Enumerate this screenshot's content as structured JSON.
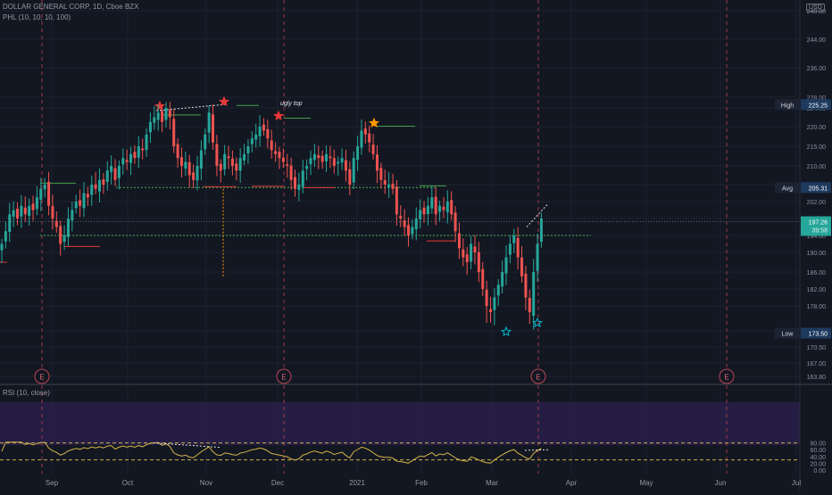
{
  "header": {
    "symbol_line": "DOLLAR GENERAL CORP, 1D, Cboe BZX",
    "indicator_line": "PHL (10, 10, 10, 100)",
    "rsi_line": "RSI (10, close)",
    "currency": "USD"
  },
  "chart_data": [
    {
      "type": "candlestick",
      "ylim": [
        163.8,
        250
      ],
      "y_ticks": [
        163.8,
        167.0,
        170.5,
        174.0,
        178.0,
        182.0,
        186.0,
        190.0,
        194.0,
        198.0,
        202.0,
        206.0,
        210.0,
        215.0,
        220.0,
        224.0,
        228.0,
        236.0,
        244.0,
        248.0
      ],
      "x_ticks": [
        "Sep",
        "Oct",
        "Nov",
        "Dec",
        "2021",
        "Feb",
        "Mar",
        "Apr",
        "May",
        "Jun",
        "Jul"
      ],
      "ohlc_close": [
        192,
        195,
        199,
        200,
        198,
        201,
        199,
        201,
        200,
        203,
        205,
        206,
        201,
        198,
        196,
        192,
        194,
        198,
        200,
        202,
        201,
        204,
        203,
        206,
        205,
        207,
        206,
        209,
        210,
        207,
        210,
        212,
        211,
        213,
        212,
        215,
        214,
        218,
        221,
        222,
        223,
        221,
        224,
        222,
        215,
        212,
        210,
        211,
        208,
        207,
        210,
        214,
        218,
        223,
        216,
        210,
        209,
        213,
        212,
        210,
        209,
        212,
        213,
        215,
        217,
        218,
        220,
        219,
        217,
        214,
        213,
        212,
        211,
        210,
        207,
        205,
        206,
        209,
        210,
        212,
        213,
        212,
        211,
        213,
        212,
        210,
        211,
        212,
        209,
        206,
        212,
        215,
        219,
        218,
        216,
        213,
        209,
        207,
        206,
        206,
        205,
        199,
        198,
        196,
        194,
        196,
        198,
        200,
        199,
        201,
        203,
        199,
        201,
        200,
        202,
        199,
        195,
        191,
        189,
        188,
        192,
        190,
        186,
        182,
        178,
        177,
        180,
        183,
        186,
        189,
        192,
        194,
        189,
        185,
        180,
        177,
        186,
        192,
        198
      ],
      "labels": {
        "high": {
          "label": "High",
          "value": 225.25
        },
        "avg": {
          "label": "Avg",
          "value": 205.31
        },
        "low": {
          "label": "Low",
          "value": 173.5
        },
        "last": {
          "value": 197.26,
          "countdown": "39:58"
        }
      },
      "annotations": [
        {
          "text": "ugly top"
        }
      ],
      "earnings_markers": [
        "E",
        "E",
        "E",
        "E"
      ]
    },
    {
      "type": "line",
      "name": "RSI (10, close)",
      "ylim": [
        -2,
        88
      ],
      "y_ticks": [
        0.0,
        20.0,
        40.0,
        60.0,
        80.0
      ],
      "bands": [
        30,
        80
      ]
    }
  ],
  "colors": {
    "background": "#131722",
    "up": "#26a69a",
    "down": "#ef5350",
    "grid": "#1e222d",
    "rsi_line": "#d4b34a",
    "rsi_band": "#2a1e4a",
    "avg_line": "#4caf50",
    "star_red": "#e53935",
    "star_orange": "#ff9800",
    "star_blue": "#00bcd4",
    "label_bg": "#1e3a5f"
  }
}
